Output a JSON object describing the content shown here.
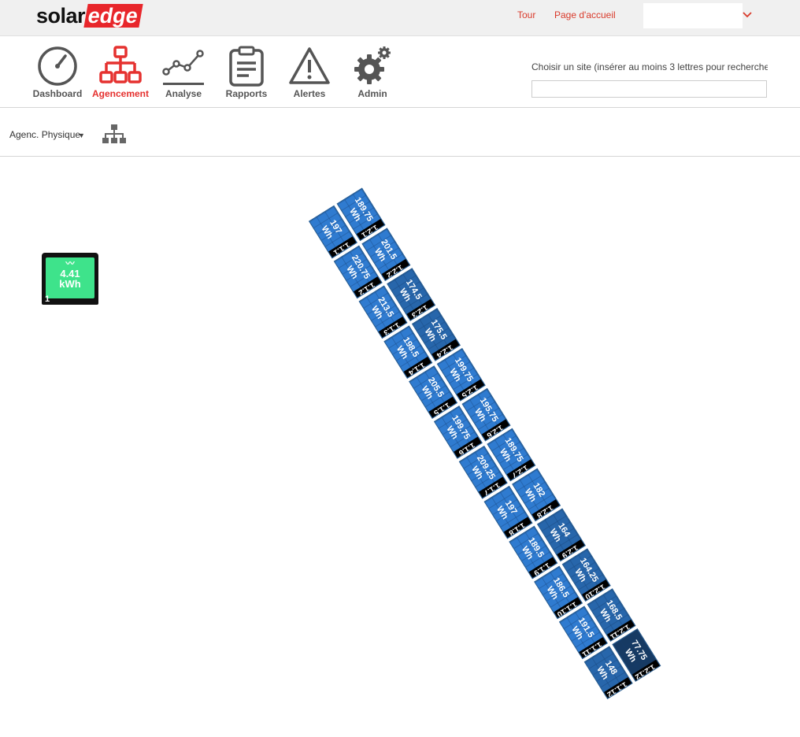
{
  "header": {
    "logo_part1": "solar",
    "logo_part2": "edge",
    "link_tour": "Tour",
    "link_home": "Page d'accueil",
    "accent_color": "#e5312f"
  },
  "nav": {
    "items": [
      {
        "label": "Dashboard",
        "icon": "gauge-icon"
      },
      {
        "label": "Agencement",
        "icon": "layout-tree-icon",
        "active": true
      },
      {
        "label": "Analyse",
        "icon": "chart-line-icon"
      },
      {
        "label": "Rapports",
        "icon": "clipboard-icon"
      },
      {
        "label": "Alertes",
        "icon": "warning-icon"
      },
      {
        "label": "Admin",
        "icon": "gear-icon"
      }
    ],
    "site_label": "Choisir un site (insérer au moins 3 lettres pour recherche",
    "site_input_value": ""
  },
  "toolbar": {
    "layout_mode": "Agenc. Physique",
    "tree_icon": "hierarchy-icon"
  },
  "inverter": {
    "energy": "4.41",
    "unit": "kWh",
    "number": "1"
  },
  "panels": {
    "row1": [
      {
        "id": "1.1.1",
        "energy": "197"
      },
      {
        "id": "1.1.2",
        "energy": "220.75"
      },
      {
        "id": "1.1.3",
        "energy": "213.5"
      },
      {
        "id": "1.1.4",
        "energy": "198.5"
      },
      {
        "id": "1.1.5",
        "energy": "205.5"
      },
      {
        "id": "1.1.6",
        "energy": "199.75"
      },
      {
        "id": "1.1.7",
        "energy": "209.25"
      },
      {
        "id": "1.1.8",
        "energy": "197"
      },
      {
        "id": "1.1.9",
        "energy": "189.5"
      },
      {
        "id": "1.1.10",
        "energy": "186.5"
      },
      {
        "id": "1.1.11",
        "energy": "191.5"
      },
      {
        "id": "1.1.12",
        "energy": "148"
      }
    ],
    "row2": [
      {
        "id": "1.2.1",
        "energy": "189.75"
      },
      {
        "id": "1.2.2",
        "energy": "201.5"
      },
      {
        "id": "1.2.3",
        "energy": "174.5"
      },
      {
        "id": "1.2.4",
        "energy": "175.5"
      },
      {
        "id": "1.2.5",
        "energy": "199.75"
      },
      {
        "id": "1.2.6",
        "energy": "195.75"
      },
      {
        "id": "1.2.7",
        "energy": "189.75"
      },
      {
        "id": "1.2.8",
        "energy": "182"
      },
      {
        "id": "1.2.9",
        "energy": "164"
      },
      {
        "id": "1.2.10",
        "energy": "164.25"
      },
      {
        "id": "1.2.11",
        "energy": "168.5"
      },
      {
        "id": "1.2.12",
        "energy": "77.75"
      }
    ],
    "unit": "Wh"
  }
}
